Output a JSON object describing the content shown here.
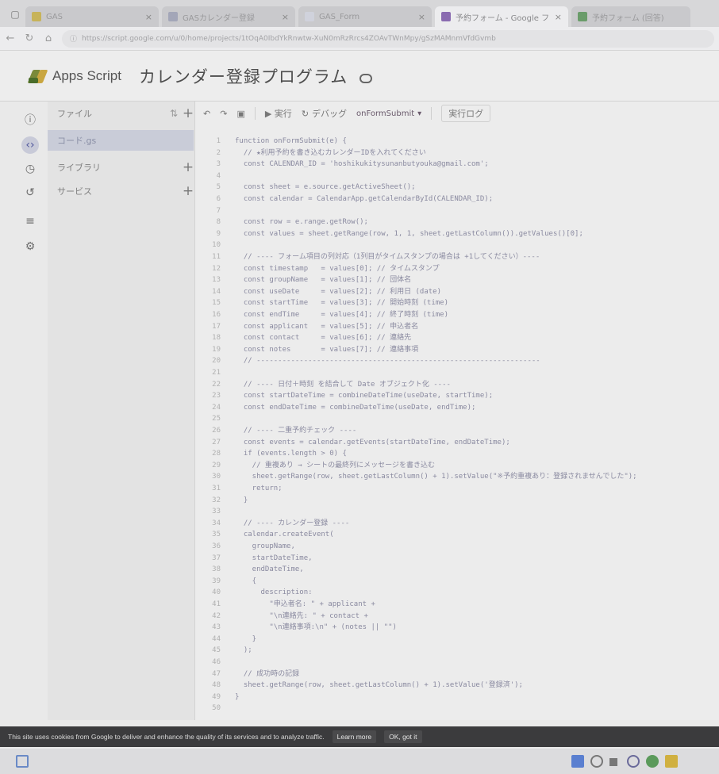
{
  "browser": {
    "tabs": [
      {
        "title": "GAS",
        "active": false
      },
      {
        "title": "GASカレンダー登録",
        "active": false
      },
      {
        "title": "GAS_Form",
        "active": false
      },
      {
        "title": "予約フォーム - Google フォーム",
        "active": true
      },
      {
        "title": "予約フォーム (回答)",
        "active": false
      }
    ],
    "url": "https://script.google.com/u/0/home/projects/1tOqA0IbdYkRnwtw-XuN0mRzRrcs4ZOAvTWnMpy/gSzMAMnmVfdGvmb"
  },
  "header": {
    "product_name": "Apps Script",
    "project_title": "カレンダー登録プログラム"
  },
  "files_panel": {
    "files_label": "ファイル",
    "selected_file": "コード.gs",
    "libraries_label": "ライブラリ",
    "services_label": "サービス"
  },
  "toolbar": {
    "undo": "↶",
    "redo": "↷",
    "run_label": "▶ 実行",
    "debug_label": "デバッグ",
    "function_name": "onFormSubmit",
    "exec_log_label": "実行ログ"
  },
  "code": [
    {
      "n": "1",
      "t": "function onFormSubmit(e) {"
    },
    {
      "n": "2",
      "t": "  // ★利用予約を書き込むカレンダーIDを入れてください"
    },
    {
      "n": "3",
      "t": "  const CALENDAR_ID = 'hoshikukitysunanbutyouka@gmail.com';"
    },
    {
      "n": "4",
      "t": ""
    },
    {
      "n": "5",
      "t": "  const sheet = e.source.getActiveSheet();"
    },
    {
      "n": "6",
      "t": "  const calendar = CalendarApp.getCalendarById(CALENDAR_ID);"
    },
    {
      "n": "7",
      "t": ""
    },
    {
      "n": "8",
      "t": "  const row = e.range.getRow();"
    },
    {
      "n": "9",
      "t": "  const values = sheet.getRange(row, 1, 1, sheet.getLastColumn()).getValues()[0];"
    },
    {
      "n": "10",
      "t": ""
    },
    {
      "n": "11",
      "t": "  // ---- フォーム項目の列対応（1列目がタイムスタンプの場合は +1してください）----"
    },
    {
      "n": "12",
      "t": "  const timestamp   = values[0]; // タイムスタンプ"
    },
    {
      "n": "13",
      "t": "  const groupName   = values[1]; // 団体名"
    },
    {
      "n": "14",
      "t": "  const useDate     = values[2]; // 利用日 (date)"
    },
    {
      "n": "15",
      "t": "  const startTime   = values[3]; // 開始時刻 (time)"
    },
    {
      "n": "16",
      "t": "  const endTime     = values[4]; // 終了時刻 (time)"
    },
    {
      "n": "17",
      "t": "  const applicant   = values[5]; // 申込者名"
    },
    {
      "n": "18",
      "t": "  const contact     = values[6]; // 連絡先"
    },
    {
      "n": "19",
      "t": "  const notes       = values[7]; // 連絡事項"
    },
    {
      "n": "20",
      "t": "  // ------------------------------------------------------------------"
    },
    {
      "n": "21",
      "t": ""
    },
    {
      "n": "22",
      "t": "  // ---- 日付＋時刻 を結合して Date オブジェクト化 ----"
    },
    {
      "n": "23",
      "t": "  const startDateTime = combineDateTime(useDate, startTime);"
    },
    {
      "n": "24",
      "t": "  const endDateTime = combineDateTime(useDate, endTime);"
    },
    {
      "n": "25",
      "t": ""
    },
    {
      "n": "26",
      "t": "  // ---- 二重予約チェック ----"
    },
    {
      "n": "27",
      "t": "  const events = calendar.getEvents(startDateTime, endDateTime);"
    },
    {
      "n": "28",
      "t": "  if (events.length > 0) {"
    },
    {
      "n": "29",
      "t": "    // 重複あり → シートの最終列にメッセージを書き込む"
    },
    {
      "n": "30",
      "t": "    sheet.getRange(row, sheet.getLastColumn() + 1).setValue(\"※予約重複あり：登録されませんでした\");"
    },
    {
      "n": "31",
      "t": "    return;"
    },
    {
      "n": "32",
      "t": "  }"
    },
    {
      "n": "33",
      "t": ""
    },
    {
      "n": "34",
      "t": "  // ---- カレンダー登録 ----"
    },
    {
      "n": "35",
      "t": "  calendar.createEvent("
    },
    {
      "n": "36",
      "t": "    groupName,"
    },
    {
      "n": "37",
      "t": "    startDateTime,"
    },
    {
      "n": "38",
      "t": "    endDateTime,"
    },
    {
      "n": "39",
      "t": "    {"
    },
    {
      "n": "40",
      "t": "      description:"
    },
    {
      "n": "41",
      "t": "        \"申込者名: \" + applicant +"
    },
    {
      "n": "42",
      "t": "        \"\\n連絡先: \" + contact +"
    },
    {
      "n": "43",
      "t": "        \"\\n連絡事項:\\n\" + (notes || \"\")"
    },
    {
      "n": "44",
      "t": "    }"
    },
    {
      "n": "45",
      "t": "  );"
    },
    {
      "n": "46",
      "t": ""
    },
    {
      "n": "47",
      "t": "  // 成功時の記録"
    },
    {
      "n": "48",
      "t": "  sheet.getRange(row, sheet.getLastColumn() + 1).setValue('登録済');"
    },
    {
      "n": "49",
      "t": "}"
    },
    {
      "n": "50",
      "t": ""
    }
  ],
  "cookie_banner": {
    "text": "This site uses cookies from Google to deliver and enhance the quality of its services and to analyze traffic.",
    "learn_more": "Learn more",
    "ok": "OK, got it"
  },
  "icons": {
    "rail": [
      "info-icon",
      "code-icon",
      "triggers-icon",
      "executions-icon",
      "editor-settings-icon",
      "settings-icon"
    ]
  },
  "colors": {
    "accent": "#50579c",
    "selected_bg": "#c9ccd8",
    "cookie_bg": "#3b3b3d"
  }
}
